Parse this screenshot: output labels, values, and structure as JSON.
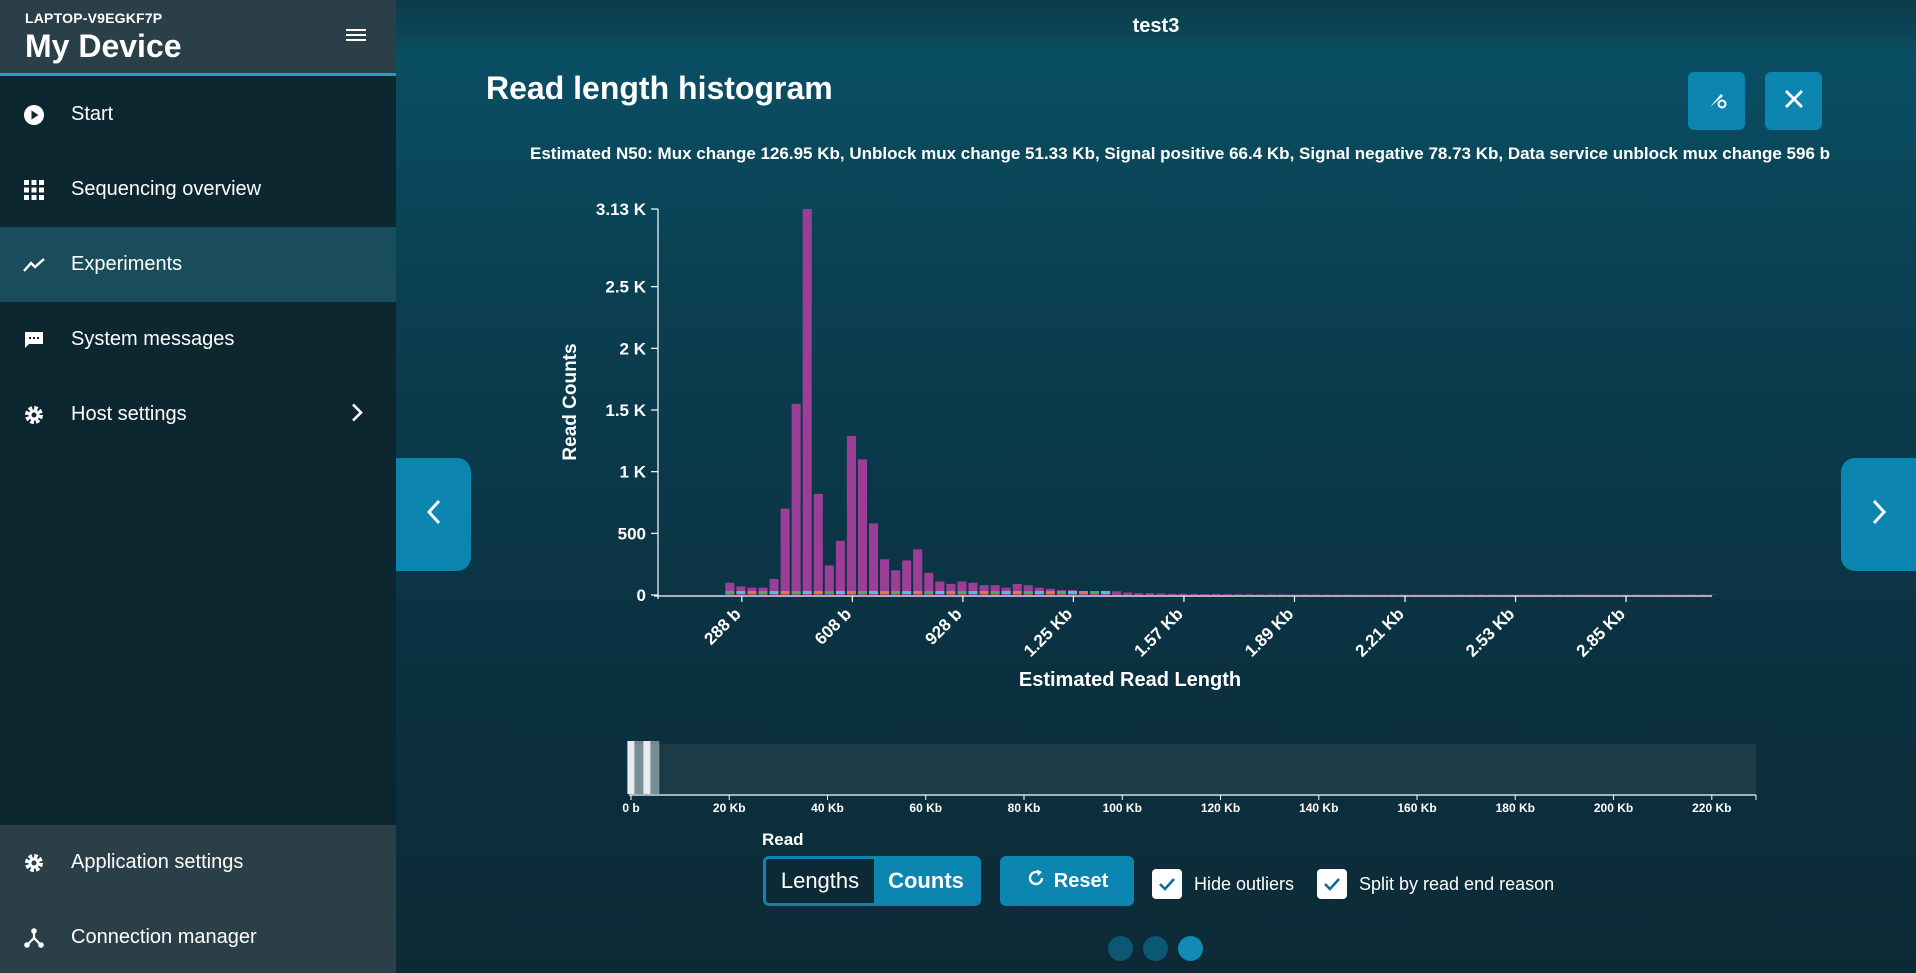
{
  "sidebar": {
    "host": "LAPTOP-V9EGKF7P",
    "device_name": "My Device",
    "items": [
      {
        "label": "Start",
        "icon": "play-circle-icon"
      },
      {
        "label": "Sequencing overview",
        "icon": "grid-icon"
      },
      {
        "label": "Experiments",
        "icon": "trend-line-icon",
        "active": true
      },
      {
        "label": "System messages",
        "icon": "chat-icon"
      },
      {
        "label": "Host settings",
        "icon": "gear-icon"
      }
    ],
    "bottom_items": [
      {
        "label": "Application settings",
        "icon": "gear-icon"
      },
      {
        "label": "Connection manager",
        "icon": "network-icon"
      }
    ]
  },
  "header": {
    "run_title": "test3"
  },
  "panel": {
    "title": "Read length histogram",
    "n50_text": "Estimated N50: Mux change 126.95 Kb, Unblock mux change 51.33 Kb, Signal positive 66.4 Kb, Signal negative 78.73 Kb, Data service unblock mux change 596 b"
  },
  "controls": {
    "read_label": "Read",
    "toggle_lengths": "Lengths",
    "toggle_counts": "Counts",
    "reset_label": "Reset",
    "hide_outliers_label": "Hide outliers",
    "hide_outliers_checked": true,
    "split_label": "Split by read end reason",
    "split_checked": true
  },
  "colors": {
    "accent": "#0c85b0",
    "bar_primary": "#9c3d97",
    "bar_green": "#4caf50",
    "bar_cyan": "#4fc3d6",
    "bar_orange": "#e07a3a"
  },
  "chart_data": {
    "type": "bar",
    "xlabel": "Estimated Read Length",
    "ylabel": "Read Counts",
    "ylim": [
      0,
      3130
    ],
    "y_ticks": [
      "0",
      "500",
      "1 K",
      "1.5 K",
      "2 K",
      "2.5 K",
      "3.13 K"
    ],
    "y_tick_values": [
      0,
      500,
      1000,
      1500,
      2000,
      2500,
      3130
    ],
    "x_ticks": [
      "288 b",
      "608 b",
      "928 b",
      "1.25 Kb",
      "1.57 Kb",
      "1.89 Kb",
      "2.21 Kb",
      "2.53 Kb",
      "2.85 Kb"
    ],
    "xlim": [
      80,
      3120
    ],
    "bin_width": 32,
    "bins_start": 80,
    "series": [
      {
        "values": [
          0,
          0,
          0,
          0,
          0,
          0,
          100,
          70,
          60,
          60,
          130,
          700,
          1550,
          3130,
          820,
          240,
          440,
          1290,
          1100,
          580,
          290,
          200,
          280,
          370,
          180,
          110,
          90,
          110,
          100,
          80,
          80,
          60,
          90,
          80,
          60,
          50,
          40,
          40,
          30,
          30,
          25,
          30,
          20,
          15,
          15,
          12,
          10,
          10,
          8,
          8,
          8,
          7,
          6,
          6,
          5,
          5,
          5,
          4,
          4,
          4,
          3,
          3,
          3,
          3,
          3,
          3,
          3,
          3,
          3,
          3,
          3,
          3,
          3,
          3,
          3,
          3,
          3,
          3,
          3,
          3,
          3,
          3,
          3,
          3,
          3,
          3,
          3,
          3,
          3,
          3,
          3,
          3,
          3,
          3,
          3,
          3
        ]
      }
    ],
    "overview": {
      "x_ticks": [
        "0 b",
        "20 Kb",
        "40 Kb",
        "60 Kb",
        "80 Kb",
        "100 Kb",
        "120 Kb",
        "140 Kb",
        "160 Kb",
        "180 Kb",
        "200 Kb",
        "220 Kb"
      ],
      "xlim": [
        0,
        229000
      ],
      "selection": [
        80,
        3120
      ]
    }
  },
  "pagination": {
    "pages": 3,
    "active": 3
  }
}
